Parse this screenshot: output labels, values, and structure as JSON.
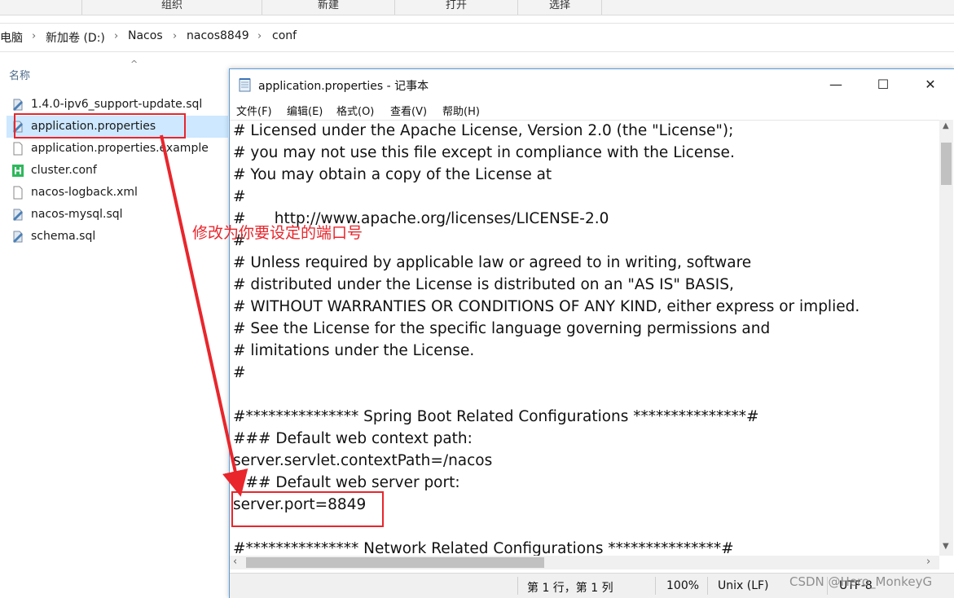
{
  "ribbon": {
    "groups": [
      "组织",
      "新建",
      "打开",
      "选择"
    ]
  },
  "breadcrumb": {
    "items": [
      "电脑",
      "新加卷 (D:)",
      "Nacos",
      "nacos8849",
      "conf"
    ]
  },
  "file_list": {
    "column_name": "名称",
    "files": [
      {
        "name": "1.4.0-ipv6_support-update.sql",
        "icon": "sql-file-icon"
      },
      {
        "name": "application.properties",
        "icon": "properties-file-icon"
      },
      {
        "name": "application.properties.example",
        "icon": "document-file-icon"
      },
      {
        "name": "cluster.conf",
        "icon": "hbuilder-file-icon"
      },
      {
        "name": "nacos-logback.xml",
        "icon": "document-file-icon"
      },
      {
        "name": "nacos-mysql.sql",
        "icon": "sql-file-icon"
      },
      {
        "name": "schema.sql",
        "icon": "sql-file-icon"
      }
    ]
  },
  "notepad": {
    "title": "application.properties - 记事本",
    "window_buttons": {
      "minimize": "—",
      "maximize": "☐",
      "close": "✕"
    },
    "menu": [
      "文件(F)",
      "编辑(E)",
      "格式(O)",
      "查看(V)",
      "帮助(H)"
    ],
    "lines": [
      "# Licensed under the Apache License, Version 2.0 (the \"License\");",
      "# you may not use this file except in compliance with the License.",
      "# You may obtain a copy of the License at",
      "#",
      "#      http://www.apache.org/licenses/LICENSE-2.0",
      "#",
      "# Unless required by applicable law or agreed to in writing, software",
      "# distributed under the License is distributed on an \"AS IS\" BASIS,",
      "# WITHOUT WARRANTIES OR CONDITIONS OF ANY KIND, either express or implied.",
      "# See the License for the specific language governing permissions and",
      "# limitations under the License.",
      "#",
      "",
      "#*************** Spring Boot Related Configurations ***************#",
      "### Default web context path:",
      "server.servlet.contextPath=/nacos",
      "### Default web server port:",
      "server.port=8849",
      "",
      "#*************** Network Related Configurations ***************#"
    ],
    "status": {
      "position": "第 1 行，第 1 列",
      "zoom": "100%",
      "line_ending": "Unix (LF)",
      "encoding": "UTF-8"
    }
  },
  "annotation": {
    "text": "修改为你要设定的端口号",
    "color": "#e8262c"
  },
  "watermark": "CSDN @Hero_MonkeyG"
}
